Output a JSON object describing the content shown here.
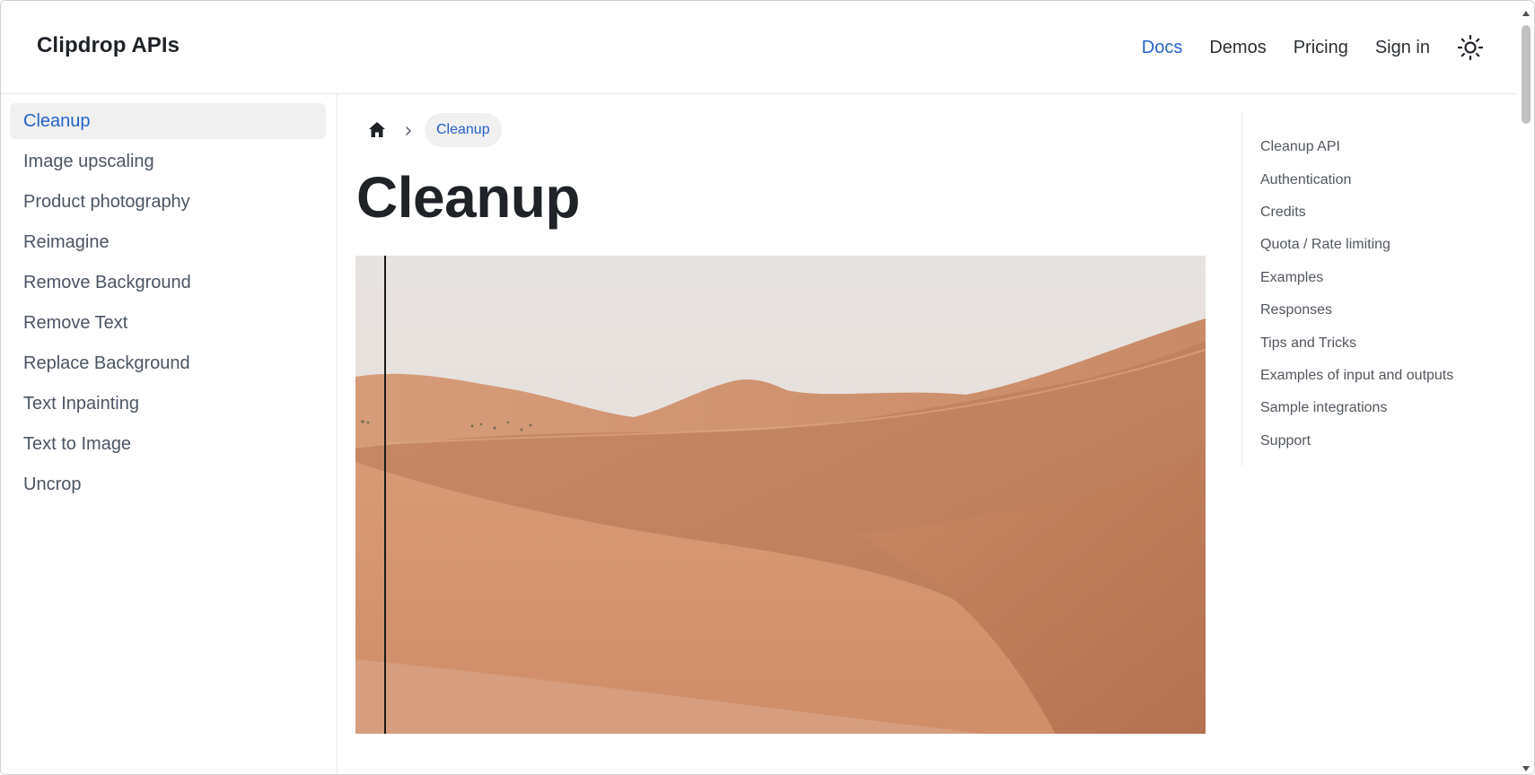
{
  "header": {
    "brand": "Clipdrop APIs",
    "nav": [
      {
        "label": "Docs",
        "active": true
      },
      {
        "label": "Demos",
        "active": false
      },
      {
        "label": "Pricing",
        "active": false
      },
      {
        "label": "Sign in",
        "active": false
      }
    ],
    "theme_toggle_icon": "sun-icon"
  },
  "sidebar": {
    "items": [
      {
        "label": "Cleanup",
        "active": true
      },
      {
        "label": "Image upscaling"
      },
      {
        "label": "Product photography"
      },
      {
        "label": "Reimagine"
      },
      {
        "label": "Remove Background"
      },
      {
        "label": "Remove Text"
      },
      {
        "label": "Replace Background"
      },
      {
        "label": "Text Inpainting"
      },
      {
        "label": "Text to Image"
      },
      {
        "label": "Uncrop"
      }
    ]
  },
  "breadcrumb": {
    "home_icon": "home-icon",
    "separator_icon": "chevron-right-icon",
    "current": "Cleanup"
  },
  "main": {
    "title": "Cleanup",
    "hero_image": "desert-dunes-photo"
  },
  "toc": {
    "items": [
      "Cleanup API",
      "Authentication",
      "Credits",
      "Quota / Rate limiting",
      "Examples",
      "Responses",
      "Tips and Tricks",
      "Examples of input and outputs",
      "Sample integrations",
      "Support"
    ]
  },
  "colors": {
    "accent": "#2563c9",
    "active_bg": "#f0f0f1",
    "text": "#1f2328",
    "muted": "#4b5563"
  }
}
